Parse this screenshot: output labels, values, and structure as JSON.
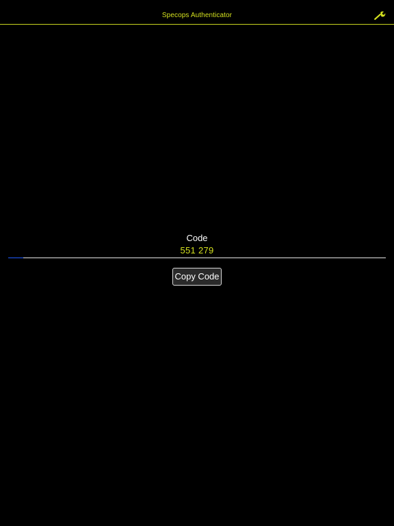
{
  "header": {
    "title": "Specops Authenticator",
    "settings_icon": "wrench-icon"
  },
  "main": {
    "code_label": "Code",
    "code_value": "551 279",
    "progress_fraction": 0.04,
    "copy_button_label": "Copy Code"
  },
  "colors": {
    "background": "#000000",
    "accent": "#d4e11f",
    "progress": "#1f5bff",
    "text": "#ffffff"
  }
}
